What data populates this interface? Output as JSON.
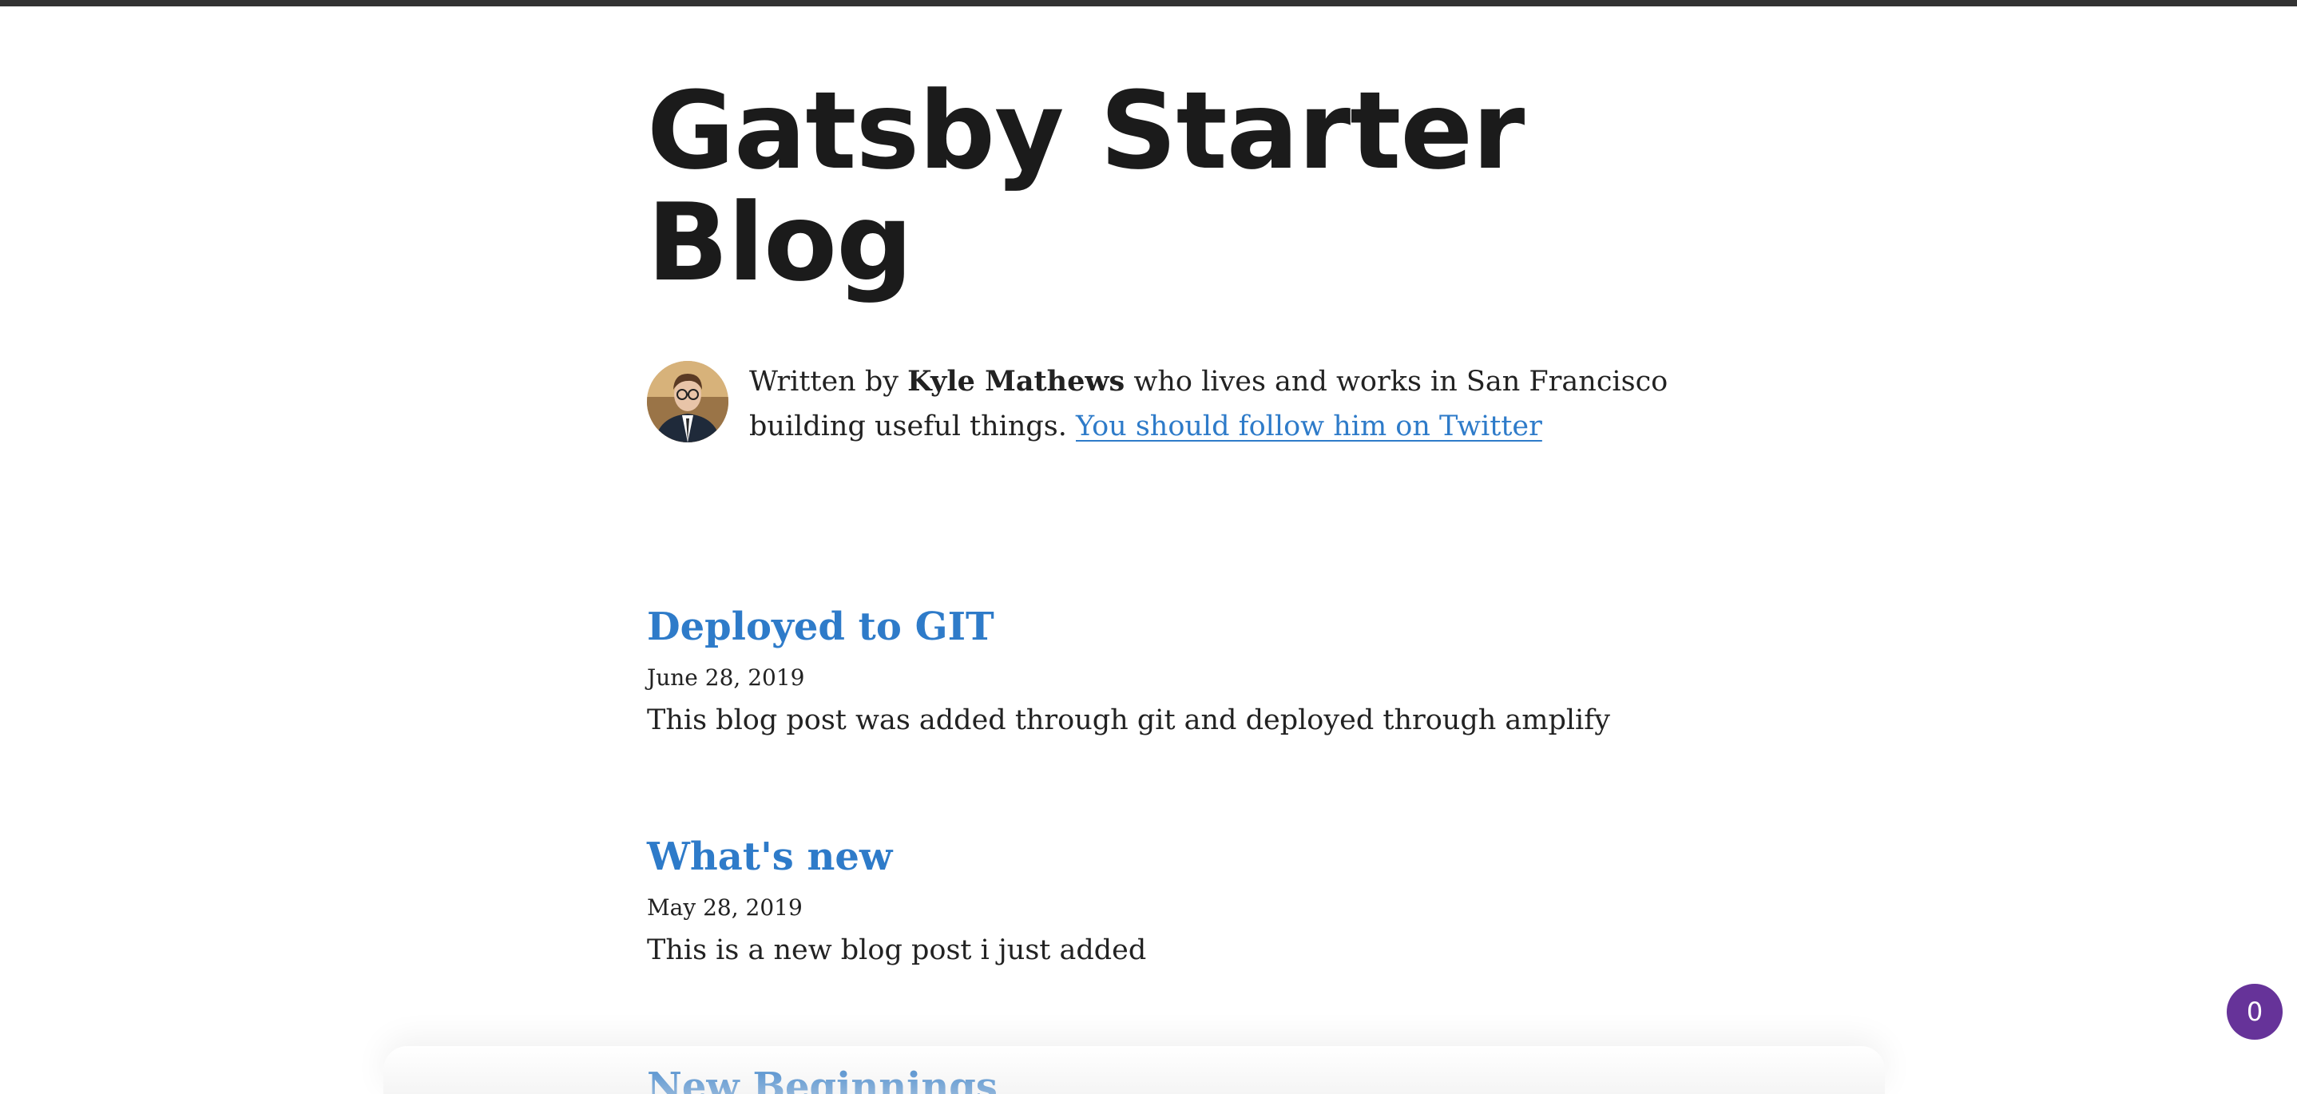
{
  "site": {
    "title": "Gatsby Starter Blog"
  },
  "bio": {
    "prefix": "Written by",
    "author": "Kyle Mathews",
    "middle": "who lives and works in San Francisco building useful things.",
    "link_text": "You should follow him on Twitter",
    "avatar_icon": "author-avatar"
  },
  "posts": [
    {
      "title": "Deployed to GIT",
      "date": "June 28, 2019",
      "excerpt": "This blog post was added through git and deployed through amplify"
    },
    {
      "title": "What's new",
      "date": "May 28, 2019",
      "excerpt": "This is a new blog post i just added"
    },
    {
      "title": "New Beginnings"
    }
  ],
  "badge": {
    "count": "0",
    "color": "#663399"
  },
  "colors": {
    "link": "#2e7bc9",
    "top_bar": "#333333"
  }
}
